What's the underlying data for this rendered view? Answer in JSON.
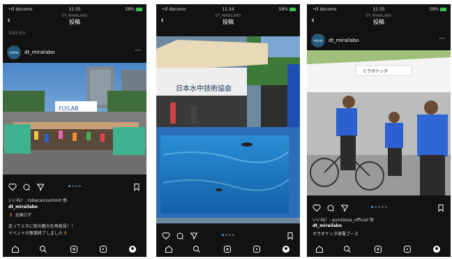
{
  "phones": [
    {
      "status": {
        "carrier": "•ıll docomo",
        "time": "11:35",
        "battery": "58%"
      },
      "subtitle": "DT_MIRAILABO",
      "title": "投稿",
      "tiny_label": "写真を見る",
      "account": {
        "avatar_text": "mirai labo",
        "username": "dt_mirailabo"
      },
      "likes": "いいね！: tobacaicsummit 他",
      "caption_user": "dt_mirailabo",
      "caption_line1": "🏃 全国ロゲ",
      "caption_line2": "走ってミネに街の魅力を再発見！！",
      "caption_line3": "イベントが無事終了しました🏃"
    },
    {
      "status": {
        "carrier": "•ıll docomo",
        "time": "11:34",
        "battery": "58%"
      },
      "subtitle": "DT_MIRAILABO",
      "title": "投稿",
      "sign_text": "日本水中技術協会"
    },
    {
      "status": {
        "carrier": "•ıll docomo",
        "time": "11:35",
        "battery": "58%"
      },
      "subtitle": "DT_MIRAILABO",
      "title": "投稿",
      "account": {
        "avatar_text": "mirai labo",
        "username": "dt_mirailabo"
      },
      "likes": "いいね！: quintessa_official 他",
      "caption_user": "dt_mirailabo",
      "caption_line1": "カラオケッタ発電ブース",
      "banner_text": "ミラボケッタ"
    }
  ],
  "colors": {
    "bg": "#121212",
    "accent": "#3897f0",
    "battery": "#35c759"
  },
  "nav_icons": [
    "home-icon",
    "search-icon",
    "add-icon",
    "reels-icon",
    "profile-icon"
  ]
}
